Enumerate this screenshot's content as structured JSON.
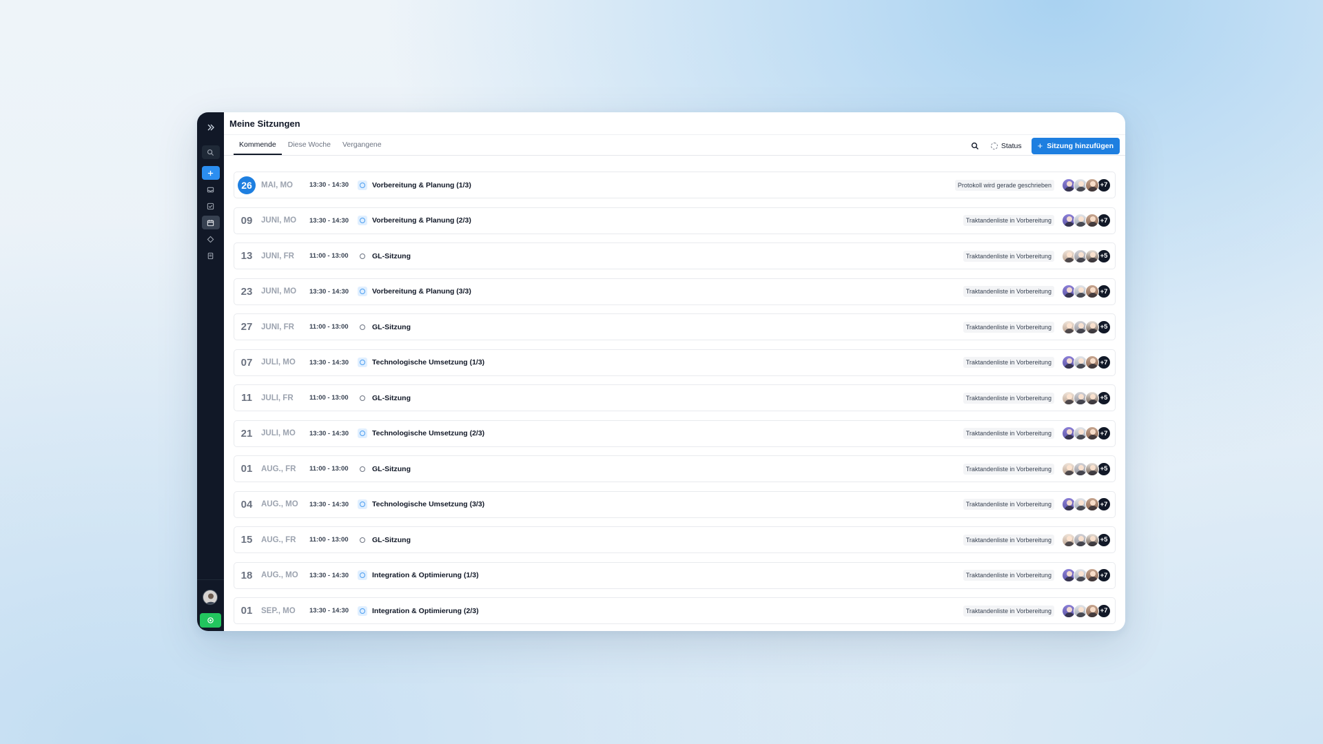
{
  "page": {
    "title": "Meine Sitzungen"
  },
  "tabs": [
    {
      "label": "Kommende"
    },
    {
      "label": "Diese Woche"
    },
    {
      "label": "Vergangene"
    }
  ],
  "toolbar": {
    "status_label": "Status",
    "add_label": "Sitzung hinzufügen",
    "add_icon": "+"
  },
  "rail": {
    "icons": [
      "expand-icon",
      "search-icon",
      "plus-icon",
      "inbox-icon",
      "checklist-icon",
      "calendar-icon",
      "tag-icon",
      "document-icon"
    ]
  },
  "meetings": [
    {
      "day": "26",
      "month": "MAI, MO",
      "time": "13:30 - 14:30",
      "name": "Vorbereitung & Planung (1/3)",
      "status": "Protokoll wird gerade geschrieben",
      "more": "+7",
      "today": true,
      "group": "a"
    },
    {
      "day": "09",
      "month": "JUNI, MO",
      "time": "13:30 - 14:30",
      "name": "Vorbereitung & Planung (2/3)",
      "status": "Traktandenliste in Vorbereitung",
      "more": "+7",
      "group": "a"
    },
    {
      "day": "13",
      "month": "JUNI, FR",
      "time": "11:00 - 13:00",
      "name": "GL-Sitzung",
      "status": "Traktandenliste in Vorbereitung",
      "more": "+5",
      "group": "b"
    },
    {
      "day": "23",
      "month": "JUNI, MO",
      "time": "13:30 - 14:30",
      "name": "Vorbereitung & Planung (3/3)",
      "status": "Traktandenliste in Vorbereitung",
      "more": "+7",
      "group": "a"
    },
    {
      "day": "27",
      "month": "JUNI, FR",
      "time": "11:00 - 13:00",
      "name": "GL-Sitzung",
      "status": "Traktandenliste in Vorbereitung",
      "more": "+5",
      "group": "b"
    },
    {
      "day": "07",
      "month": "JULI, MO",
      "time": "13:30 - 14:30",
      "name": "Technologische Umsetzung (1/3)",
      "status": "Traktandenliste in Vorbereitung",
      "more": "+7",
      "group": "a"
    },
    {
      "day": "11",
      "month": "JULI, FR",
      "time": "11:00 - 13:00",
      "name": "GL-Sitzung",
      "status": "Traktandenliste in Vorbereitung",
      "more": "+5",
      "group": "b"
    },
    {
      "day": "21",
      "month": "JULI, MO",
      "time": "13:30 - 14:30",
      "name": "Technologische Umsetzung (2/3)",
      "status": "Traktandenliste in Vorbereitung",
      "more": "+7",
      "group": "a"
    },
    {
      "day": "01",
      "month": "AUG., FR",
      "time": "11:00 - 13:00",
      "name": "GL-Sitzung",
      "status": "Traktandenliste in Vorbereitung",
      "more": "+5",
      "group": "b"
    },
    {
      "day": "04",
      "month": "AUG., MO",
      "time": "13:30 - 14:30",
      "name": "Technologische Umsetzung (3/3)",
      "status": "Traktandenliste in Vorbereitung",
      "more": "+7",
      "group": "a"
    },
    {
      "day": "15",
      "month": "AUG., FR",
      "time": "11:00 - 13:00",
      "name": "GL-Sitzung",
      "status": "Traktandenliste in Vorbereitung",
      "more": "+5",
      "group": "b"
    },
    {
      "day": "18",
      "month": "AUG., MO",
      "time": "13:30 - 14:30",
      "name": "Integration & Optimierung (1/3)",
      "status": "Traktandenliste in Vorbereitung",
      "more": "+7",
      "group": "a"
    },
    {
      "day": "01",
      "month": "SEP., MO",
      "time": "13:30 - 14:30",
      "name": "Integration & Optimierung (2/3)",
      "status": "Traktandenliste in Vorbereitung",
      "more": "+7",
      "group": "a"
    }
  ],
  "colors": {
    "accent": "#1e7fe0",
    "rail": "#111827",
    "app_button": "#22c55e"
  }
}
